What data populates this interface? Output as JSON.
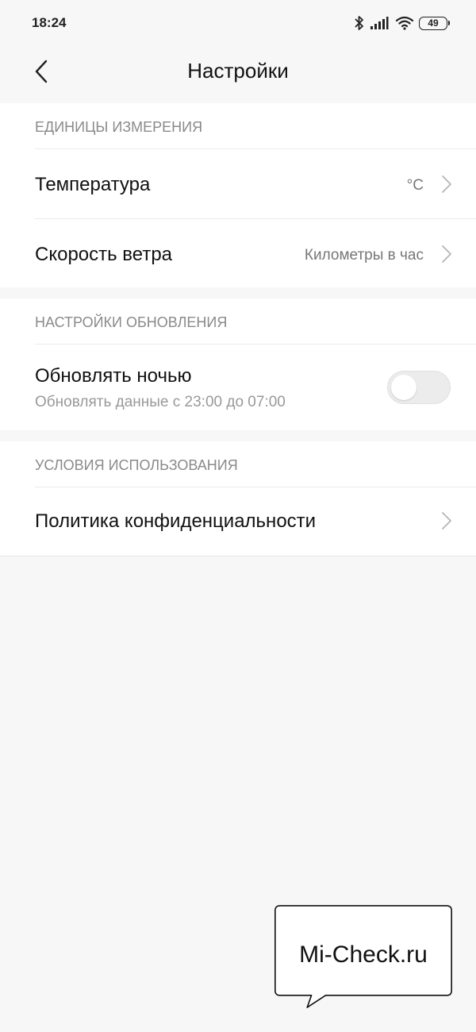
{
  "status_bar": {
    "time": "18:24",
    "battery": "49",
    "icons": [
      "bluetooth-icon",
      "signal-icon",
      "wifi-icon",
      "battery-icon"
    ]
  },
  "header": {
    "title": "Настройки",
    "back_icon": "chevron-left-icon"
  },
  "sections": {
    "units": {
      "title": "ЕДИНИЦЫ ИЗМЕРЕНИЯ",
      "temperature": {
        "label": "Температура",
        "value": "°C"
      },
      "wind": {
        "label": "Скорость ветра",
        "value": "Километры в час"
      }
    },
    "update": {
      "title": "НАСТРОЙКИ ОБНОВЛЕНИЯ",
      "night_update": {
        "label": "Обновлять ночью",
        "subtitle": "Обновлять данные с 23:00 до 07:00",
        "enabled": false
      }
    },
    "terms": {
      "title": "УСЛОВИЯ ИСПОЛЬЗОВАНИЯ",
      "privacy": {
        "label": "Политика конфиденциальности"
      }
    }
  },
  "watermark": {
    "text": "Mi-Check.ru"
  },
  "colors": {
    "background": "#f7f7f7",
    "card": "#ffffff",
    "section_title": "#8a8a8a",
    "toggle_off": "#ececec"
  }
}
